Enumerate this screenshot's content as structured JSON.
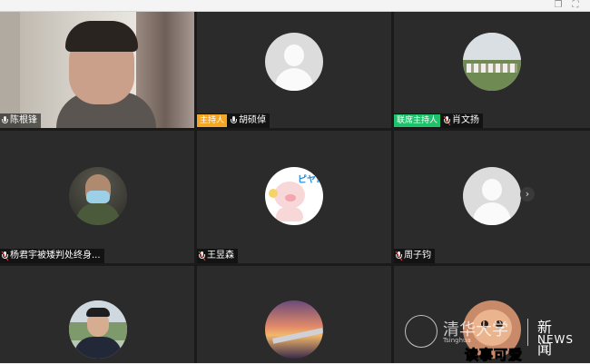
{
  "window": {
    "copy_icon": "copy-icon",
    "fullscreen_icon": "fullscreen-icon"
  },
  "colors": {
    "host_badge": "#f5a623",
    "cohost_badge": "#1ec26a",
    "muted_mic_slash": "#e04a3a"
  },
  "participants": [
    {
      "name": "陈根锋",
      "badge": "",
      "mic": "on",
      "avatar": "camera-video"
    },
    {
      "name": "胡硕倬",
      "badge": "主持人",
      "mic": "on",
      "avatar": "default-avatar"
    },
    {
      "name": "肖文扬",
      "badge": "联席主持人",
      "mic": "muted",
      "avatar": "photo-sheep"
    },
    {
      "name": "杨君宇被矮判处终身...",
      "badge": "",
      "mic": "muted",
      "avatar": "photo-masked-man"
    },
    {
      "name": "王昱森",
      "badge": "",
      "mic": "muted",
      "avatar": "photo-cartoon-pig"
    },
    {
      "name": "周子钧",
      "badge": "",
      "mic": "muted",
      "avatar": "default-avatar"
    },
    {
      "name": "",
      "badge": "",
      "mic": "",
      "avatar": "photo-man-suit"
    },
    {
      "name": "",
      "badge": "",
      "mic": "",
      "avatar": "photo-sunset-wing"
    },
    {
      "name": "",
      "badge": "",
      "mic": "",
      "avatar": "photo-pet"
    }
  ],
  "pig_sticker_text": "ピヤ!",
  "bottom_caption": "读事可爱",
  "watermark": {
    "logo_text": "清华大学",
    "sub_text": "Tsinghua",
    "news_cn": "新闻",
    "news_en": "NEWS"
  }
}
